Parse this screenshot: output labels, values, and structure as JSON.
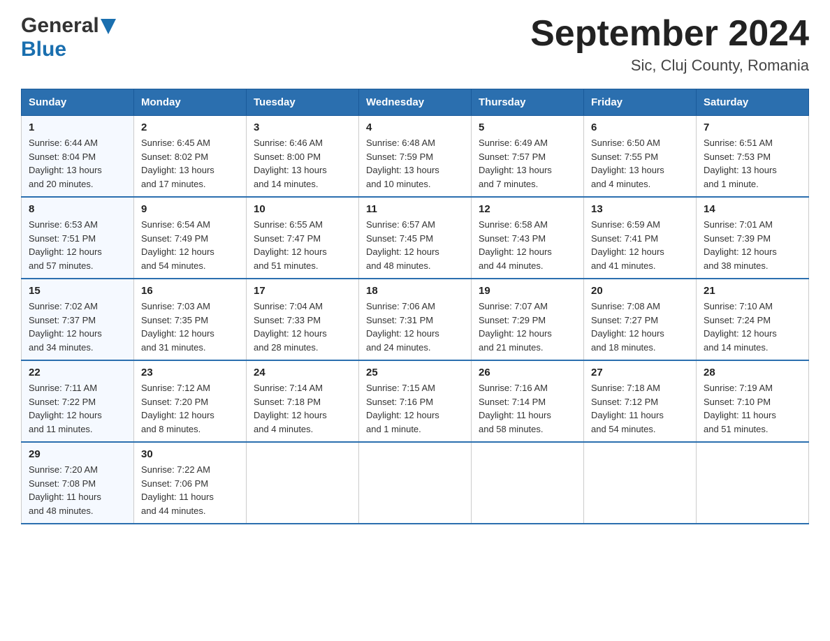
{
  "header": {
    "logo_general": "General",
    "logo_blue": "Blue",
    "month_year": "September 2024",
    "location": "Sic, Cluj County, Romania"
  },
  "days_of_week": [
    "Sunday",
    "Monday",
    "Tuesday",
    "Wednesday",
    "Thursday",
    "Friday",
    "Saturday"
  ],
  "weeks": [
    [
      {
        "day": "1",
        "sunrise": "6:44 AM",
        "sunset": "8:04 PM",
        "daylight": "13 hours and 20 minutes."
      },
      {
        "day": "2",
        "sunrise": "6:45 AM",
        "sunset": "8:02 PM",
        "daylight": "13 hours and 17 minutes."
      },
      {
        "day": "3",
        "sunrise": "6:46 AM",
        "sunset": "8:00 PM",
        "daylight": "13 hours and 14 minutes."
      },
      {
        "day": "4",
        "sunrise": "6:48 AM",
        "sunset": "7:59 PM",
        "daylight": "13 hours and 10 minutes."
      },
      {
        "day": "5",
        "sunrise": "6:49 AM",
        "sunset": "7:57 PM",
        "daylight": "13 hours and 7 minutes."
      },
      {
        "day": "6",
        "sunrise": "6:50 AM",
        "sunset": "7:55 PM",
        "daylight": "13 hours and 4 minutes."
      },
      {
        "day": "7",
        "sunrise": "6:51 AM",
        "sunset": "7:53 PM",
        "daylight": "13 hours and 1 minute."
      }
    ],
    [
      {
        "day": "8",
        "sunrise": "6:53 AM",
        "sunset": "7:51 PM",
        "daylight": "12 hours and 57 minutes."
      },
      {
        "day": "9",
        "sunrise": "6:54 AM",
        "sunset": "7:49 PM",
        "daylight": "12 hours and 54 minutes."
      },
      {
        "day": "10",
        "sunrise": "6:55 AM",
        "sunset": "7:47 PM",
        "daylight": "12 hours and 51 minutes."
      },
      {
        "day": "11",
        "sunrise": "6:57 AM",
        "sunset": "7:45 PM",
        "daylight": "12 hours and 48 minutes."
      },
      {
        "day": "12",
        "sunrise": "6:58 AM",
        "sunset": "7:43 PM",
        "daylight": "12 hours and 44 minutes."
      },
      {
        "day": "13",
        "sunrise": "6:59 AM",
        "sunset": "7:41 PM",
        "daylight": "12 hours and 41 minutes."
      },
      {
        "day": "14",
        "sunrise": "7:01 AM",
        "sunset": "7:39 PM",
        "daylight": "12 hours and 38 minutes."
      }
    ],
    [
      {
        "day": "15",
        "sunrise": "7:02 AM",
        "sunset": "7:37 PM",
        "daylight": "12 hours and 34 minutes."
      },
      {
        "day": "16",
        "sunrise": "7:03 AM",
        "sunset": "7:35 PM",
        "daylight": "12 hours and 31 minutes."
      },
      {
        "day": "17",
        "sunrise": "7:04 AM",
        "sunset": "7:33 PM",
        "daylight": "12 hours and 28 minutes."
      },
      {
        "day": "18",
        "sunrise": "7:06 AM",
        "sunset": "7:31 PM",
        "daylight": "12 hours and 24 minutes."
      },
      {
        "day": "19",
        "sunrise": "7:07 AM",
        "sunset": "7:29 PM",
        "daylight": "12 hours and 21 minutes."
      },
      {
        "day": "20",
        "sunrise": "7:08 AM",
        "sunset": "7:27 PM",
        "daylight": "12 hours and 18 minutes."
      },
      {
        "day": "21",
        "sunrise": "7:10 AM",
        "sunset": "7:24 PM",
        "daylight": "12 hours and 14 minutes."
      }
    ],
    [
      {
        "day": "22",
        "sunrise": "7:11 AM",
        "sunset": "7:22 PM",
        "daylight": "12 hours and 11 minutes."
      },
      {
        "day": "23",
        "sunrise": "7:12 AM",
        "sunset": "7:20 PM",
        "daylight": "12 hours and 8 minutes."
      },
      {
        "day": "24",
        "sunrise": "7:14 AM",
        "sunset": "7:18 PM",
        "daylight": "12 hours and 4 minutes."
      },
      {
        "day": "25",
        "sunrise": "7:15 AM",
        "sunset": "7:16 PM",
        "daylight": "12 hours and 1 minute."
      },
      {
        "day": "26",
        "sunrise": "7:16 AM",
        "sunset": "7:14 PM",
        "daylight": "11 hours and 58 minutes."
      },
      {
        "day": "27",
        "sunrise": "7:18 AM",
        "sunset": "7:12 PM",
        "daylight": "11 hours and 54 minutes."
      },
      {
        "day": "28",
        "sunrise": "7:19 AM",
        "sunset": "7:10 PM",
        "daylight": "11 hours and 51 minutes."
      }
    ],
    [
      {
        "day": "29",
        "sunrise": "7:20 AM",
        "sunset": "7:08 PM",
        "daylight": "11 hours and 48 minutes."
      },
      {
        "day": "30",
        "sunrise": "7:22 AM",
        "sunset": "7:06 PM",
        "daylight": "11 hours and 44 minutes."
      },
      null,
      null,
      null,
      null,
      null
    ]
  ],
  "labels": {
    "sunrise": "Sunrise:",
    "sunset": "Sunset:",
    "daylight": "Daylight:"
  }
}
